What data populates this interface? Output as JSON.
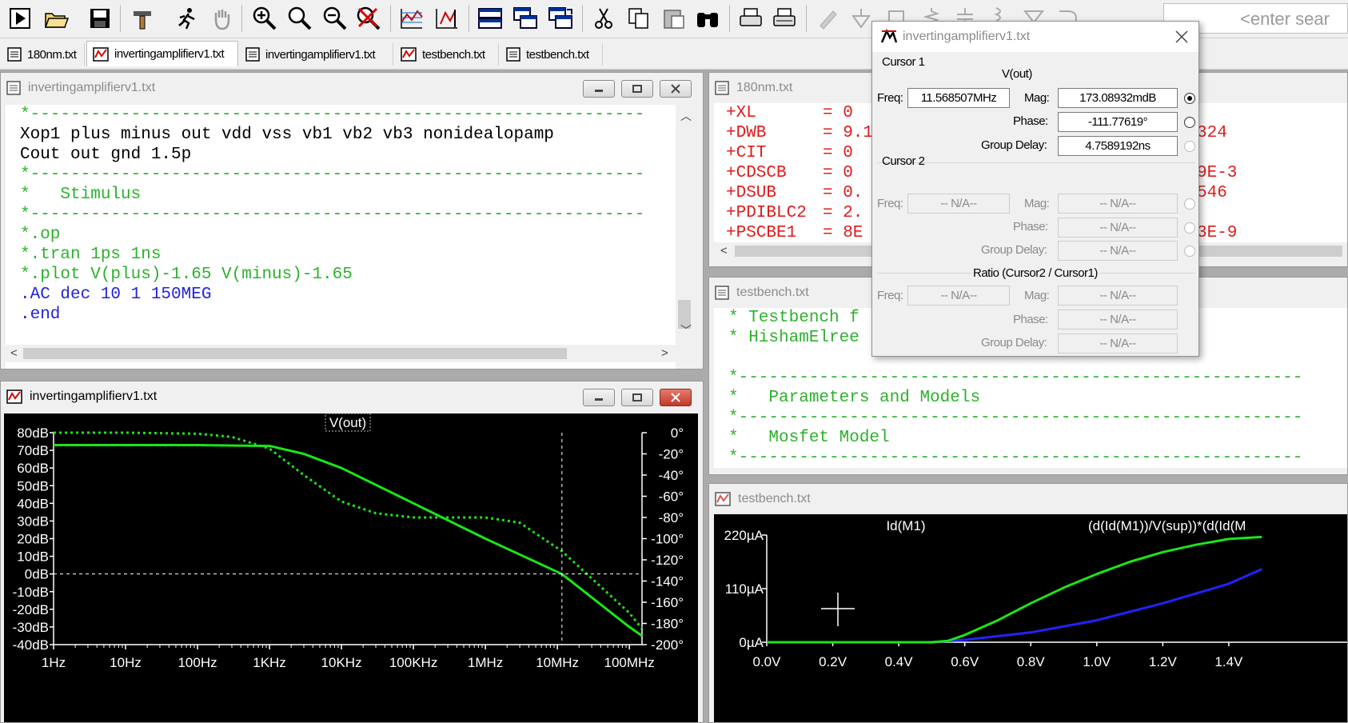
{
  "toolbar": {
    "search_placeholder": "<enter sear",
    "buttons": [
      "run",
      "open",
      "save",
      "control-panel",
      "run-sim",
      "halt",
      "zoom-in",
      "zoom-full",
      "zoom-out",
      "zoom-cancel",
      "autorange",
      "manual-limits",
      "tile-horizontal",
      "cascade",
      "tile-vertical",
      "cut",
      "copy",
      "paste",
      "find",
      "print",
      "print-setup",
      "draw-wire",
      "ground",
      "label",
      "resistor",
      "capacitor",
      "inductor",
      "diode",
      "component"
    ]
  },
  "tabs": [
    {
      "label": "180nm.txt",
      "icon": "netlist-icon",
      "active": false
    },
    {
      "label": "invertingamplifierv1.txt",
      "icon": "waveform-icon",
      "active": true
    },
    {
      "label": "invertingamplifierv1.txt",
      "icon": "netlist-icon",
      "active": false
    },
    {
      "label": "testbench.txt",
      "icon": "waveform-icon",
      "active": false
    },
    {
      "label": "testbench.txt",
      "icon": "netlist-icon",
      "active": false
    }
  ],
  "netlist_window": {
    "title": "invertingamplifierv1.txt",
    "lines": [
      {
        "text": "*-------------------------------------------------------------",
        "color": "green"
      },
      {
        "text": "Xop1 plus minus out vdd vss vb1 vb2 vb3 nonidealopamp",
        "color": "black"
      },
      {
        "text": "Cout out gnd 1.5p",
        "color": "black"
      },
      {
        "text": "*-------------------------------------------------------------",
        "color": "green"
      },
      {
        "text": "*   Stimulus",
        "color": "green"
      },
      {
        "text": "*-------------------------------------------------------------",
        "color": "green"
      },
      {
        "text": "*.op",
        "color": "green"
      },
      {
        "text": "*.tran 1ps 1ns",
        "color": "green"
      },
      {
        "text": "*.plot V(plus)-1.65 V(minus)-1.65",
        "color": "green"
      },
      {
        "text": ".AC dec 10 1 150MEG",
        "color": "blue"
      },
      {
        "text": ".end",
        "color": "blue"
      }
    ]
  },
  "model_window": {
    "title": "180nm.txt",
    "lines": [
      {
        "a": "+XL",
        "b": "= 0",
        "c": ""
      },
      {
        "a": "+DWB",
        "b": "= 9.1",
        "c": "324"
      },
      {
        "a": "+CIT",
        "b": "= 0",
        "c": ""
      },
      {
        "a": "+CDSCB",
        "b": "= 0",
        "c": "9E-3"
      },
      {
        "a": "+DSUB",
        "b": "= 0.",
        "c": "546"
      },
      {
        "a": "+PDIBLC2",
        "b": "= 2.",
        "c": ""
      },
      {
        "a": "+PSCBE1",
        "b": "= 8E",
        "c": "3E-9"
      }
    ]
  },
  "testbench_text_window": {
    "title": "testbench.txt",
    "lines": [
      {
        "text": "* Testbench f",
        "color": "green"
      },
      {
        "text": "* HishamElree",
        "color": "green"
      },
      {
        "text": "",
        "color": "green"
      },
      {
        "text": "*--------------------------------------------------------",
        "color": "green"
      },
      {
        "text": "*   Parameters and Models",
        "color": "green"
      },
      {
        "text": "*--------------------------------------------------------",
        "color": "green"
      },
      {
        "text": "*   Mosfet Model",
        "color": "green"
      },
      {
        "text": "*--------------------------------------------------------",
        "color": "green"
      }
    ]
  },
  "bode_window": {
    "title": "invertingamplifierv1.txt",
    "trace_label": "V(out)",
    "left_ticks": [
      "80dB",
      "70dB",
      "60dB",
      "50dB",
      "40dB",
      "30dB",
      "20dB",
      "10dB",
      "0dB",
      "-10dB",
      "-20dB",
      "-30dB",
      "-40dB"
    ],
    "right_ticks": [
      "0°",
      "-20°",
      "-40°",
      "-60°",
      "-80°",
      "-100°",
      "-120°",
      "-140°",
      "-160°",
      "-180°",
      "-200°"
    ],
    "x_ticks": [
      "1Hz",
      "10Hz",
      "100Hz",
      "1KHz",
      "10KHz",
      "100KHz",
      "1MHz",
      "10MHz",
      "100MHz"
    ]
  },
  "testbench_plot_window": {
    "title": "testbench.txt",
    "trace_labels": [
      "Id(M1)",
      "(d(Id(M1))/V(sup))*(d(Id(M"
    ],
    "y_ticks": [
      "220µA",
      "110µA",
      "0µA"
    ],
    "x_ticks": [
      "0.0V",
      "0.2V",
      "0.4V",
      "0.6V",
      "0.8V",
      "1.0V",
      "1.2V",
      "1.4V"
    ]
  },
  "chart_data": [
    {
      "type": "line",
      "title": "V(out)",
      "x_scale": "log",
      "xlim": [
        1,
        150000000
      ],
      "ylim_left": [
        -40,
        80
      ],
      "ylim_right": [
        -200,
        0
      ],
      "series": [
        {
          "name": "V(out)",
          "style": "solid",
          "axis": "left",
          "x": [
            1,
            10,
            100,
            1000,
            3000,
            10000,
            100000,
            1000000,
            11568507,
            100000000,
            150000000
          ],
          "y": [
            73,
            73,
            73,
            72.5,
            68,
            60,
            40,
            20,
            0,
            -30,
            -35
          ]
        },
        {
          "name": "V(out)",
          "style": "dotted",
          "axis": "right",
          "x": [
            1,
            10,
            100,
            300,
            1000,
            3000,
            10000,
            30000,
            100000,
            300000,
            1000000,
            3000000,
            11568507,
            100000000,
            150000000
          ],
          "y": [
            0,
            0,
            -1,
            -4,
            -15,
            -40,
            -65,
            -76,
            -80,
            -80,
            -80,
            -85,
            -111.8,
            -170,
            -185
          ]
        }
      ],
      "cursor": {
        "x": 11568507,
        "y": 0
      }
    },
    {
      "type": "line",
      "xlim": [
        0,
        1.5
      ],
      "ylim": [
        0,
        220
      ],
      "series": [
        {
          "name": "Id(M1)",
          "color": "#2222ff",
          "x": [
            0,
            0.5,
            0.6,
            0.8,
            1.0,
            1.2,
            1.4,
            1.5
          ],
          "y": [
            0,
            0,
            5,
            20,
            45,
            80,
            120,
            150
          ]
        },
        {
          "name": "(d(Id(M1))/V(sup))*(d(Id(M",
          "color": "#19e619",
          "x": [
            0,
            0.5,
            0.55,
            0.6,
            0.7,
            0.8,
            0.9,
            1.0,
            1.1,
            1.2,
            1.3,
            1.4,
            1.5
          ],
          "y": [
            0,
            0,
            3,
            15,
            45,
            80,
            112,
            140,
            165,
            185,
            200,
            212,
            216
          ]
        }
      ]
    }
  ],
  "cursor_dialog": {
    "title": "invertingamplifierv1.txt",
    "cursor1_label": "Cursor 1",
    "trace": "V(out)",
    "freq_label": "Freq:",
    "freq": "11.568507MHz",
    "mag_label": "Mag:",
    "mag": "173.08932mdB",
    "phase_label": "Phase:",
    "phase": "-111.77619°",
    "gd_label": "Group Delay:",
    "gd": "4.7589192ns",
    "cursor2_label": "Cursor 2",
    "c2_freq": "-- N/A--",
    "c2_mag": "-- N/A--",
    "c2_phase": "-- N/A--",
    "c2_gd": "-- N/A--",
    "ratio_label": "Ratio (Cursor2 / Cursor1)",
    "r_freq": "-- N/A--",
    "r_mag": "-- N/A--",
    "r_phase": "-- N/A--",
    "r_gd": "-- N/A--"
  },
  "colors": {
    "trace_green": "#19e619",
    "trace_blue": "#2222ff",
    "comment_green": "#2cb12c",
    "directive_blue": "#2222dd",
    "model_red": "#e01b1b"
  }
}
